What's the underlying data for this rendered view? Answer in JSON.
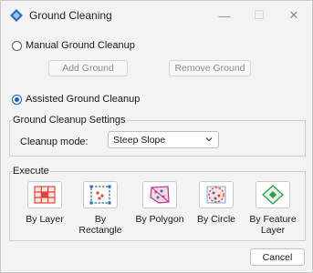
{
  "window": {
    "title": "Ground Cleaning",
    "minimize_glyph": "—",
    "maximize_glyph": "☐",
    "close_glyph": "✕"
  },
  "manual": {
    "label": "Manual Ground Cleanup",
    "selected": false,
    "add_label": "Add Ground",
    "remove_label": "Remove Ground"
  },
  "assisted": {
    "label": "Assisted Ground Cleanup",
    "selected": true
  },
  "settings": {
    "title": "Ground Cleanup Settings",
    "mode_label": "Cleanup mode:",
    "mode_value": "Steep Slope"
  },
  "execute": {
    "title": "Execute",
    "tools": [
      {
        "label": "By Layer",
        "icon": "layer-grid-icon"
      },
      {
        "label": "By Rectangle",
        "icon": "rectangle-select-icon"
      },
      {
        "label": "By Polygon",
        "icon": "polygon-select-icon"
      },
      {
        "label": "By Circle",
        "icon": "circle-select-icon"
      },
      {
        "label": "By Feature Layer",
        "icon": "feature-layer-icon"
      }
    ]
  },
  "cancel_label": "Cancel",
  "colors": {
    "accent": "#1b5fb5",
    "tool_red": "#e0453a",
    "tool_blue": "#2f6fb3",
    "tool_green": "#2e9a4a"
  }
}
